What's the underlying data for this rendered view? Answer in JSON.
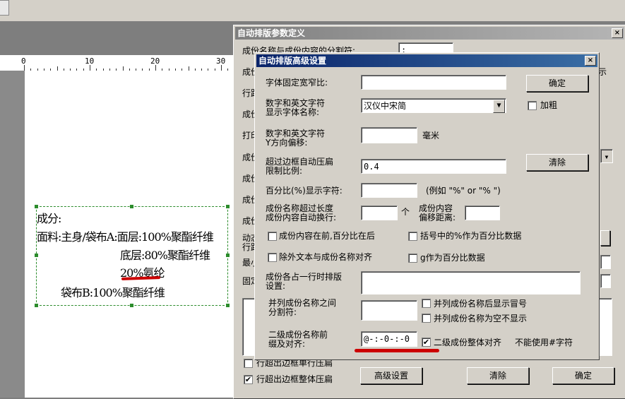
{
  "editor": {
    "ruler_numbers": [
      "0",
      "10",
      "20",
      "30"
    ],
    "paper_lines": [
      "成分:",
      "面料:主身/袋布A:面层:100%聚酯纤维",
      "底层:80%聚酯纤维",
      "20%氨纶",
      "袋布B:100%聚酯纤维"
    ]
  },
  "outer_dialog": {
    "title": "自动排版参数定义",
    "close": "×",
    "row1_label": "成份名称与成份内容的分割符:",
    "row1_value": ":",
    "partial_labels": [
      "成份",
      "行距",
      "成份",
      "打印",
      "成份",
      "成份",
      "成份",
      "成份",
      "成份",
      "动态",
      "行距",
      "最小",
      "固定"
    ],
    "right_text": "示",
    "chk_stretch_row": "行超出边框整体压扁",
    "chk_stretch_row_checked": "✔",
    "chk_partial": "行超出边框单行压扁",
    "btn_advanced": "高级设置",
    "btn_clear": "清除",
    "btn_ok": "确定"
  },
  "inner_dialog": {
    "title": "自动排版高级设置",
    "close": "×",
    "font_width_label": "字体固定宽窄比:",
    "font_width_value": "",
    "ok_button": "确定",
    "digit_font_label": "数字和英文字符\n显示字体名称:",
    "digit_font_value": "汉仪中宋简",
    "bold_label": "加粗",
    "y_offset_label": "数字和英文字符\nY方向偏移:",
    "y_offset_value": "",
    "mm_unit": "毫米",
    "compress_label": "超过边框自动压扁\n限制比例:",
    "compress_value": "0.4",
    "clear_button": "清除",
    "percent_label": "百分比(%)显示字符:",
    "percent_value": "",
    "percent_example": "(例如 \"%\" or \"% \")",
    "wrap_label": "成份名称超过长度\n成份内容自动换行:",
    "wrap_value": "",
    "wrap_unit": "个",
    "indent_label": "成份内容\n偏移距离:",
    "indent_value": "",
    "chk_content_first": "成份内容在前,百分比在后",
    "chk_bracket_percent": "括号中的%作为百分比数据",
    "chk_align_extra": "除外文本与成份名称对齐",
    "chk_g_percent": "g作为百分比数据",
    "one_line_label": "成份各占一行时排版\n设置:",
    "one_line_value": "",
    "sep_label": "并列成份名称之间\n分割符:",
    "sep_value": "",
    "chk_colon": "并列成份名称后显示冒号",
    "chk_empty_name": "并列成份名称为空不显示",
    "prefix_label": "二级成份名称前\n缀及对齐:",
    "prefix_value": "@-:-0-:-0",
    "chk_whole_align": "二级成份整体对齐",
    "chk_whole_align_mark": "✔",
    "no_hash_note": "不能使用#字符"
  },
  "colors": {
    "title_active": "#0a246a",
    "title_inactive": "#808080",
    "annotation_red": "#cc0000",
    "handle_green": "#2c8c2c"
  }
}
